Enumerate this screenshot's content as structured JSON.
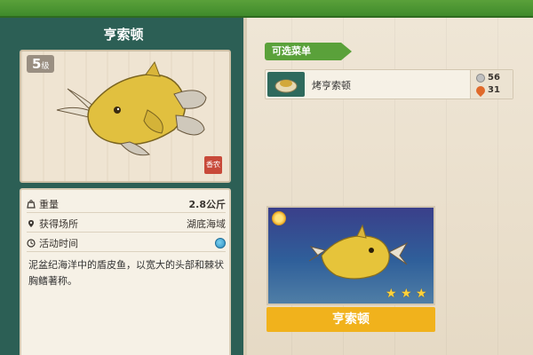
{
  "panel": {
    "title": "亨索顿",
    "level_number": "5",
    "level_suffix": "级",
    "seal_text": "香农"
  },
  "info": {
    "weight_label": "重量",
    "weight_value": "2.8公斤",
    "location_label": "获得场所",
    "location_value": "湖底海域",
    "time_label": "活动时间",
    "description": "泥盆纪海洋中的盾皮鱼，以宽大的头部和棘状胸鳍著称。"
  },
  "menu": {
    "tab_label": "可选菜单",
    "items": [
      {
        "label": "烤亨索顿",
        "coin_value": "56",
        "heat_value": "31"
      }
    ]
  },
  "preview": {
    "stars": 3,
    "name": "亨索顿"
  },
  "colors": {
    "panel_green": "#2c5f55",
    "accent_green": "#5aa13a",
    "name_bar_gold": "#f1b21c"
  }
}
